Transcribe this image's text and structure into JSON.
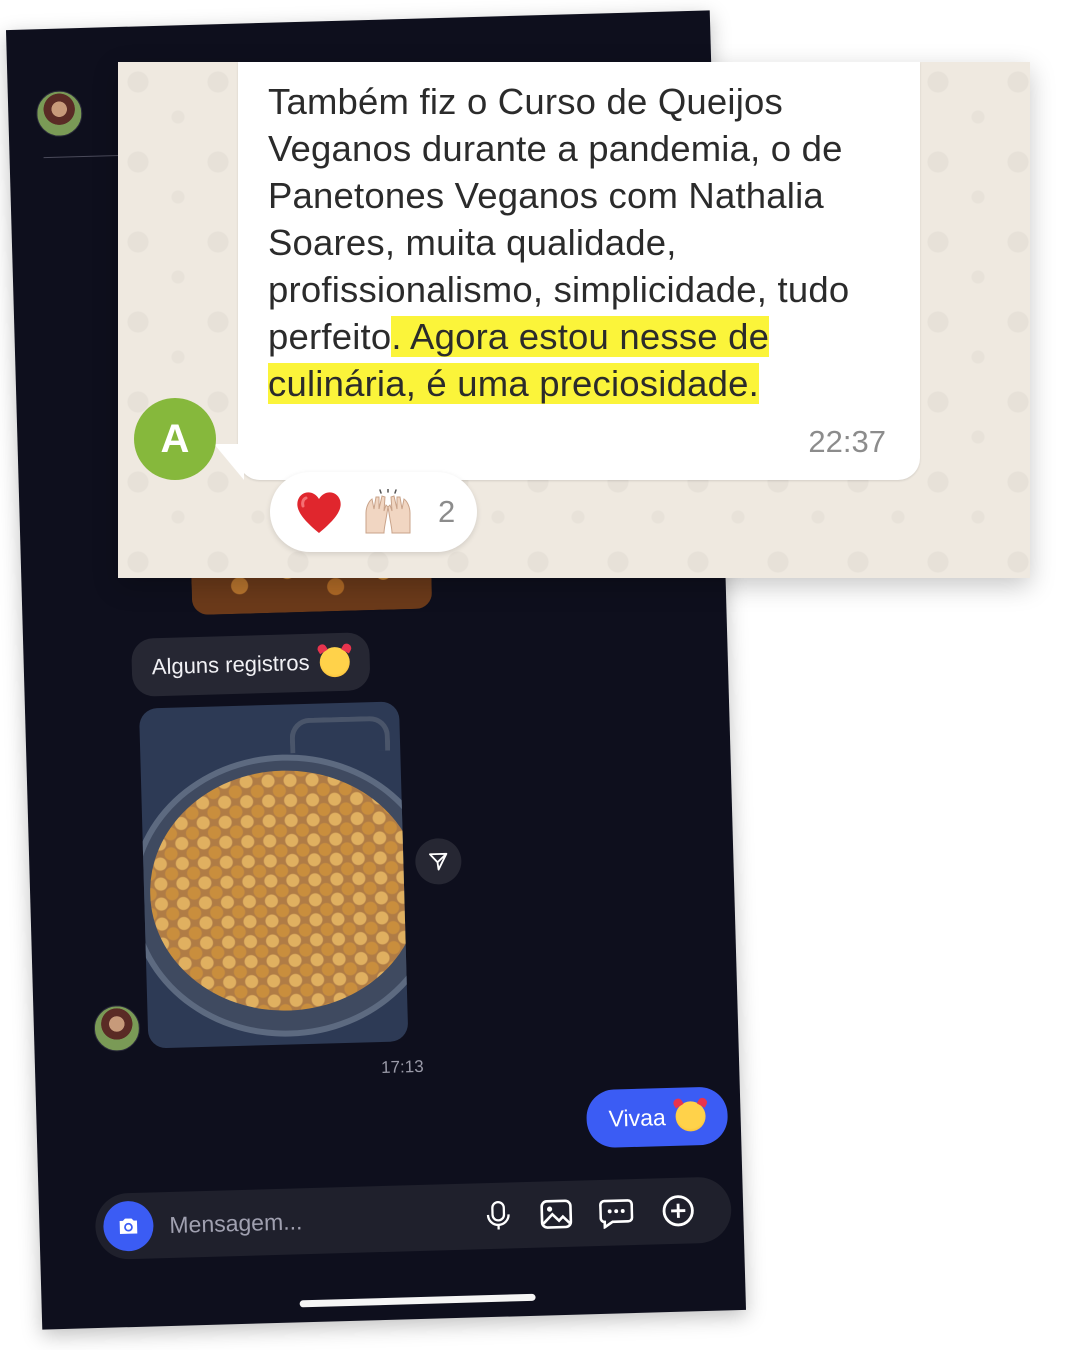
{
  "whatsapp": {
    "message_text": "Também fiz o Curso de Queijos Veganos durante a pandemia,  o de Panetones Veganos com Nathalia Soares, muita qualidade, profissionalismo, simplicidade, tudo perfeito",
    "message_highlight": ". Agora estou nesse de culinária, é uma preciosidade.",
    "time": "22:37",
    "sender_initial": "A",
    "reactions": [
      {
        "icon": "red-heart-icon"
      },
      {
        "icon": "raising-hands-icon"
      }
    ],
    "reaction_count": "2",
    "highlight_color": "#fbf43a"
  },
  "instagram": {
    "caption": "Alguns registros",
    "caption_emoji": "smiling-face-with-hearts-icon",
    "photo_time": "17:13",
    "reply_text": "Vivaa",
    "reply_emoji": "smiling-face-with-hearts-icon",
    "composer_placeholder": "Mensagem...",
    "accent_color": "#3b5cf4",
    "background_color": "#0e0f1d"
  }
}
